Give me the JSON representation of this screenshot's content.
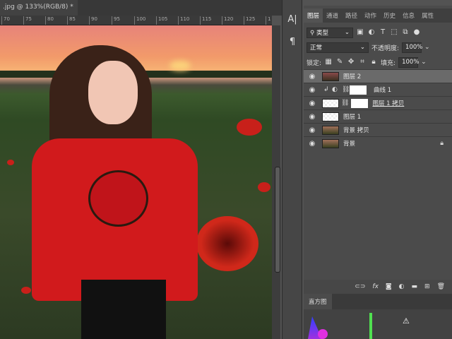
{
  "document": {
    "tab_title": ".jpg @ 133%(RGB/8) *",
    "close": "×"
  },
  "ruler": {
    "ticks": [
      "70",
      "75",
      "80",
      "85",
      "90",
      "95",
      "100",
      "105",
      "110",
      "115",
      "120",
      "125",
      "1"
    ]
  },
  "tools": {
    "character": "A|",
    "paragraph": "¶"
  },
  "layers_panel": {
    "tabs": [
      "图层",
      "通道",
      "路径",
      "动作",
      "历史",
      "信息",
      "属性"
    ],
    "filter_kind": "类型",
    "blend_mode": "正常",
    "opacity_label": "不透明度:",
    "opacity_value": "100%",
    "lock_label": "锁定:",
    "fill_label": "填充:",
    "fill_value": "100%",
    "layers": [
      {
        "name": "图层 2",
        "selected": true
      },
      {
        "name": "曲线 1",
        "type": "adjustment"
      },
      {
        "name": "图层 1 拷贝",
        "mask": true
      },
      {
        "name": "图层 1"
      },
      {
        "name": "背景 拷贝"
      },
      {
        "name": "背景",
        "locked": true
      }
    ],
    "bottom_icons": [
      "link",
      "fx",
      "mask",
      "adjustment",
      "group",
      "new-layer",
      "delete"
    ]
  },
  "histogram": {
    "tab": "直方图",
    "warning": "⚠"
  }
}
